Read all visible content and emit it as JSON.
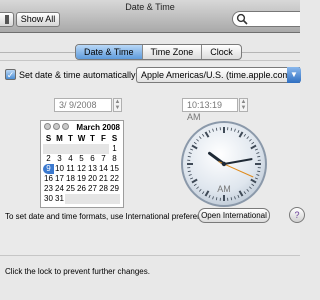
{
  "window": {
    "title": "Date & Time"
  },
  "toolbar": {
    "show_all_label": "Show All",
    "search_placeholder": ""
  },
  "tabs": [
    {
      "label": "Date & Time",
      "active": true
    },
    {
      "label": "Time Zone",
      "active": false
    },
    {
      "label": "Clock",
      "active": false
    }
  ],
  "auto": {
    "checked": true,
    "check_glyph": "✓",
    "label": "Set date & time automatically:",
    "server": "Apple Americas/U.S. (time.apple.com)"
  },
  "date_field": {
    "value": "3/ 9/2008"
  },
  "time_field": {
    "value": "10:13:19 AM"
  },
  "calendar": {
    "month_label": "March 2008",
    "day_headers": [
      "S",
      "M",
      "T",
      "W",
      "T",
      "F",
      "S"
    ],
    "weeks": [
      [
        "",
        "",
        "",
        "",
        "",
        "",
        "1"
      ],
      [
        "2",
        "3",
        "4",
        "5",
        "6",
        "7",
        "8"
      ],
      [
        "9",
        "10",
        "11",
        "12",
        "13",
        "14",
        "15"
      ],
      [
        "16",
        "17",
        "18",
        "19",
        "20",
        "21",
        "22"
      ],
      [
        "23",
        "24",
        "25",
        "26",
        "27",
        "28",
        "29"
      ],
      [
        "30",
        "31",
        "",
        "",
        "",
        "",
        ""
      ]
    ],
    "selected_day": "9"
  },
  "clock": {
    "hours": 10,
    "minutes": 13,
    "seconds": 19,
    "ampm": "AM"
  },
  "international": {
    "text": "To set date and time formats, use International preferences.",
    "button_label": "Open International",
    "help_label": "?"
  },
  "lock": {
    "text": "Click the lock to prevent further changes."
  },
  "colors": {
    "accent": "#3b79cf",
    "second_hand": "#e08a1a"
  }
}
